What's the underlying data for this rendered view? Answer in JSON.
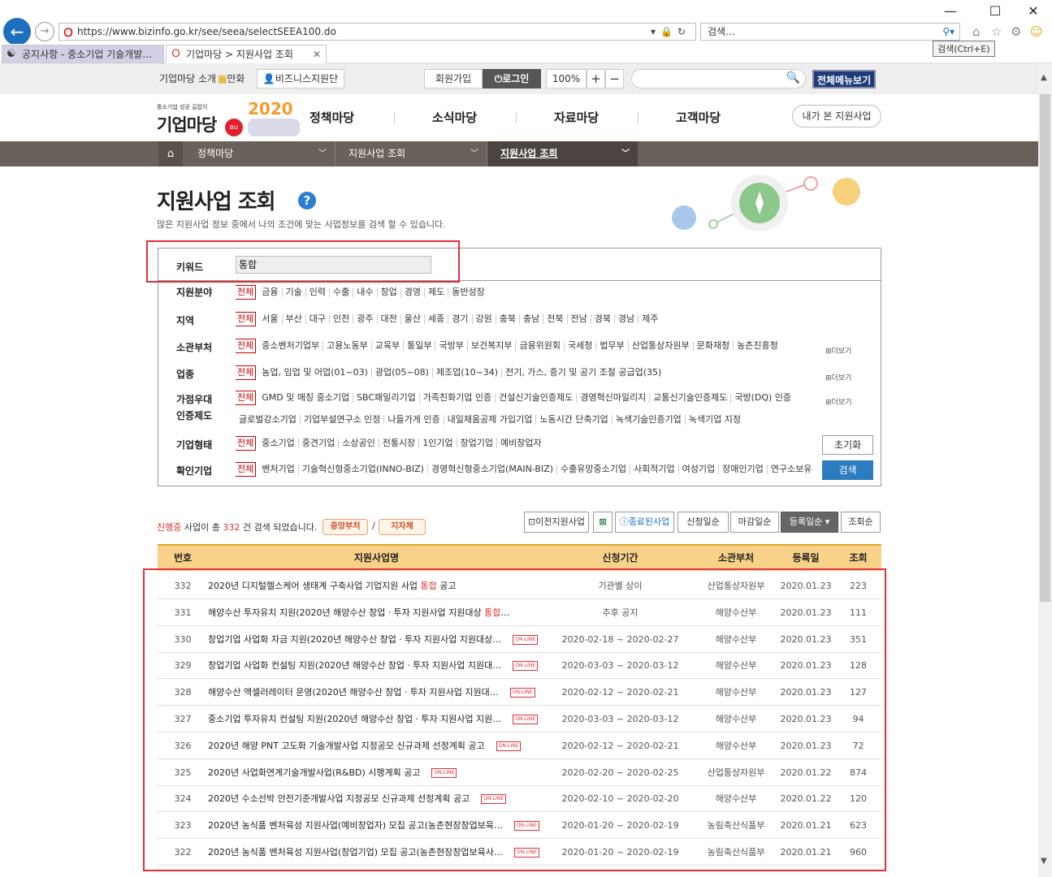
{
  "browser": {
    "url": "https://www.bizinfo.go.kr/see/seea/selectSEEA100.do",
    "search_placeholder": "검색...",
    "tooltip": "검색(Ctrl+E)",
    "tabs": [
      {
        "label": "공지사항 - 중소기업 기술개발..."
      },
      {
        "label": "기업마당 > 지원사업 조회"
      }
    ]
  },
  "util": {
    "about": "기업마당 소개",
    "manhwa": "만화",
    "biz_support": "비즈니스지원단",
    "join": "회원가입",
    "login": "로그인",
    "zoom": "100%",
    "plus": "+",
    "minus": "−",
    "all_menu": "전체메뉴보기"
  },
  "logo": {
    "tagline": "중소기업 성공 길잡이",
    "name": "기업마당",
    "badge": "Biz info",
    "year": "2020"
  },
  "gnb": {
    "items": [
      "정책마당",
      "소식마당",
      "자료마당",
      "고객마당"
    ],
    "my_support": "내가 본 지원사업"
  },
  "breadcrumb": [
    "정책마당",
    "지원사업 조회",
    "지원사업 조회"
  ],
  "page": {
    "title": "지원사업 조회",
    "help": "?",
    "subtitle": "많은 지원사업 정보 중에서 나의 조건에 맞는 사업정보를 검색 할 수 있습니다."
  },
  "filter": {
    "keyword_label": "키워드",
    "keyword_value": "통합",
    "all": "전체",
    "more": "⊞더보기",
    "reset": "초기화",
    "search": "검색",
    "rows": [
      {
        "label": "지원분야",
        "options": [
          "금융",
          "기술",
          "인력",
          "수출",
          "내수",
          "창업",
          "경영",
          "제도",
          "동반성장"
        ]
      },
      {
        "label": "지역",
        "options": [
          "서울",
          "부산",
          "대구",
          "인천",
          "광주",
          "대전",
          "울산",
          "세종",
          "경기",
          "강원",
          "충북",
          "충남",
          "전북",
          "전남",
          "경북",
          "경남",
          "제주"
        ]
      },
      {
        "label": "소관부처",
        "options": [
          "중소벤처기업부",
          "고용노동부",
          "교육부",
          "통일부",
          "국방부",
          "보건복지부",
          "금융위원회",
          "국세청",
          "법무부",
          "산업통상자원부",
          "문화재청",
          "농촌진흥청"
        ]
      },
      {
        "label": "업종",
        "options": [
          "농업, 임업 및 어업(01~03)",
          "광업(05~08)",
          "제조업(10~34)",
          "전기, 가스, 증기 및 공기 조절 공급업(35)"
        ]
      },
      {
        "label": "가점우대",
        "label2": "인증제도",
        "options": [
          "GMD 및 매칭 중소기업",
          "SBC패밀리기업",
          "가족친화기업 인증",
          "건설신기술인증제도",
          "경영혁신마일리지",
          "교통신기술인증제도",
          "국방(DQ) 인증"
        ],
        "options2": [
          "글로벌강소기업",
          "기업부설연구소 인정",
          "나들가게 인증",
          "내일채움공제 가입기업",
          "노동시간 단축기업",
          "녹색기술인증기업",
          "녹색기업 지정"
        ]
      },
      {
        "label": "기업형태",
        "options": [
          "중소기업",
          "중견기업",
          "소상공인",
          "전통시장",
          "1인기업",
          "창업기업",
          "예비창업자"
        ]
      },
      {
        "label": "확인기업",
        "options": [
          "벤처기업",
          "기술혁신형중소기업(INNO-BIZ)",
          "경영혁신형중소기업(MAIN-BIZ)",
          "수출유망중소기업",
          "사회적기업",
          "여성기업",
          "장애인기업",
          "연구소보유"
        ]
      }
    ]
  },
  "summary": {
    "status": "진행중",
    "text1": " 사업이 총 ",
    "count": "332",
    "text2": " 건 검색 되었습니다.",
    "badge1": "중앙부처",
    "slash": "/",
    "badge2": "지자체"
  },
  "sort_buttons": [
    "이전지원사업",
    "",
    "종료된사업",
    "신청일순",
    "마감일순",
    "등록일순 ▾",
    "조회순"
  ],
  "table": {
    "headers": [
      "번호",
      "지원사업명",
      "신청기간",
      "소관부처",
      "등록일",
      "조회"
    ],
    "online_badge": "ON-LINE",
    "rows": [
      {
        "no": "332",
        "title_pre": "2020년 디지털헬스케어 생태계 구축사업 기업지원 사업 ",
        "hl": "통합",
        "title_post": " 공고",
        "online": false,
        "period": "기관별 상이",
        "dept": "산업통상자원부",
        "date": "2020.01.23",
        "views": "223"
      },
      {
        "no": "331",
        "title_pre": "해양수산 투자유치 지원(2020년 해양수산 창업ㆍ투자 지원사업 지원대상 ",
        "hl": "통합",
        "title_post": "…",
        "online": false,
        "period": "추후 공지",
        "dept": "해양수산부",
        "date": "2020.01.23",
        "views": "111"
      },
      {
        "no": "330",
        "title_pre": "창업기업 사업화 자금 지원(2020년 해양수산 창업ㆍ투자 지원사업 지원대상…",
        "hl": "",
        "title_post": "",
        "online": true,
        "period": "2020-02-18 ~ 2020-02-27",
        "dept": "해양수산부",
        "date": "2020.01.23",
        "views": "351"
      },
      {
        "no": "329",
        "title_pre": "창업기업 사업화 컨설팅 지원(2020년 해양수산 창업ㆍ투자 지원사업 지원대…",
        "hl": "",
        "title_post": "",
        "online": true,
        "period": "2020-03-03 ~ 2020-03-12",
        "dept": "해양수산부",
        "date": "2020.01.23",
        "views": "128"
      },
      {
        "no": "328",
        "title_pre": "해양수산 액셀러레이터 운영(2020년 해양수산 창업ㆍ투자 지원사업 지원대…",
        "hl": "",
        "title_post": "",
        "online": true,
        "period": "2020-02-12 ~ 2020-02-21",
        "dept": "해양수산부",
        "date": "2020.01.23",
        "views": "127"
      },
      {
        "no": "327",
        "title_pre": "중소기업 투자유치 컨설팅 지원(2020년 해양수산 창업ㆍ투자 지원사업 지원…",
        "hl": "",
        "title_post": "",
        "online": true,
        "period": "2020-03-03 ~ 2020-03-12",
        "dept": "해양수산부",
        "date": "2020.01.23",
        "views": "94"
      },
      {
        "no": "326",
        "title_pre": "2020년 해양 PNT 고도화 기술개발사업 지정공모 신규과제 선정계획 공고",
        "hl": "",
        "title_post": "",
        "online": true,
        "period": "2020-02-12 ~ 2020-02-21",
        "dept": "해양수산부",
        "date": "2020.01.23",
        "views": "72"
      },
      {
        "no": "325",
        "title_pre": "2020년 사업화연계기술개발사업(R&BD) 시행계획 공고",
        "hl": "",
        "title_post": "",
        "online": true,
        "period": "2020-02-20 ~ 2020-02-25",
        "dept": "산업통상자원부",
        "date": "2020.01.22",
        "views": "874"
      },
      {
        "no": "324",
        "title_pre": "2020년 수소선박 안전기준개발사업 지정공모 신규과제 선정계획 공고",
        "hl": "",
        "title_post": "",
        "online": true,
        "period": "2020-02-10 ~ 2020-02-20",
        "dept": "해양수산부",
        "date": "2020.01.22",
        "views": "120"
      },
      {
        "no": "323",
        "title_pre": "2020년 농식품 벤처육성 지원사업(예비창업자) 모집 공고(농촌현장창업보육…",
        "hl": "",
        "title_post": "",
        "online": true,
        "period": "2020-01-20 ~ 2020-02-19",
        "dept": "농림축산식품부",
        "date": "2020.01.21",
        "views": "623"
      },
      {
        "no": "322",
        "title_pre": "2020년 농식품 벤처육성 지원사업(창업기업) 모집 공고(농촌현장창업보육사…",
        "hl": "",
        "title_post": "",
        "online": true,
        "period": "2020-01-20 ~ 2020-02-19",
        "dept": "농림축산식품부",
        "date": "2020.01.21",
        "views": "960"
      }
    ]
  }
}
